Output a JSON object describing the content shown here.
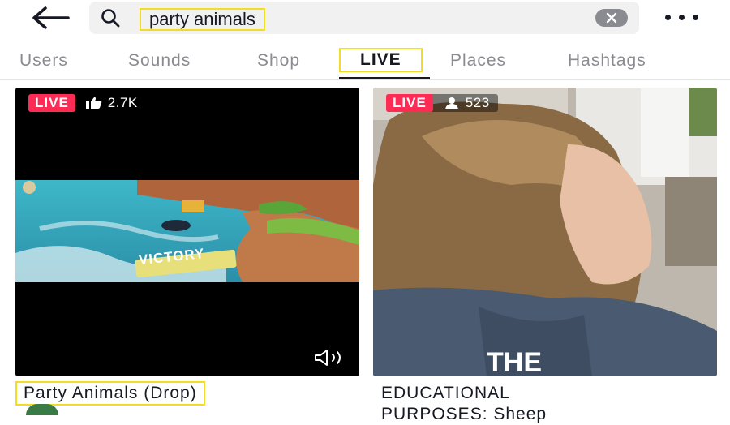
{
  "search": {
    "query": "party animals"
  },
  "tabs": [
    {
      "label": "Users"
    },
    {
      "label": "Sounds"
    },
    {
      "label": "Shop"
    },
    {
      "label": "LIVE"
    },
    {
      "label": "Places"
    },
    {
      "label": "Hashtags"
    }
  ],
  "active_tab": "LIVE",
  "results": [
    {
      "badge": "LIVE",
      "stat_icon": "thumbs-up-icon",
      "stat": "2.7K",
      "title": "Party Animals (Drop)",
      "overlay_text": "VICTORY"
    },
    {
      "badge": "LIVE",
      "stat_icon": "person-icon",
      "stat": "523",
      "title_line1": "EDUCATIONAL",
      "title_line2": "PURPOSES: Sheep"
    }
  ],
  "colors": {
    "live_badge": "#fe2c55",
    "highlight_box": "#f2dc28",
    "search_bg": "#f1f1f2"
  }
}
